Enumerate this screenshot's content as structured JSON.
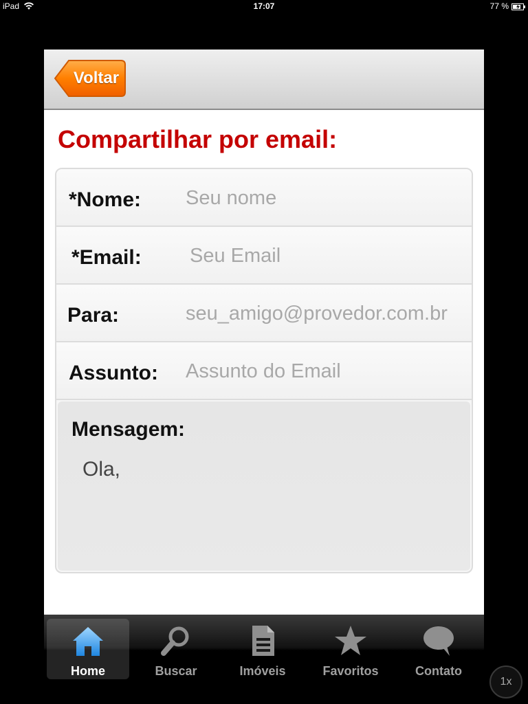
{
  "status_bar": {
    "device": "iPad",
    "time": "17:07",
    "battery": "77 %"
  },
  "header": {
    "back_label": "Voltar"
  },
  "page": {
    "title": "Compartilhar por email:"
  },
  "form": {
    "name": {
      "label": "*Nome:",
      "placeholder": "Seu nome",
      "value": ""
    },
    "email": {
      "label": "*Email:",
      "placeholder": "Seu Email",
      "value": ""
    },
    "to": {
      "label": "Para:",
      "placeholder": "seu_amigo@provedor.com.br",
      "value": ""
    },
    "subject": {
      "label": "Assunto:",
      "placeholder": "Assunto do Email",
      "value": ""
    },
    "message": {
      "label": "Mensagem:",
      "value": "Ola,"
    }
  },
  "tabbar": {
    "tabs": [
      {
        "label": "Home",
        "icon": "home-icon",
        "active": true
      },
      {
        "label": "Buscar",
        "icon": "search-icon",
        "active": false
      },
      {
        "label": "Imóveis",
        "icon": "document-icon",
        "active": false
      },
      {
        "label": "Favoritos",
        "icon": "star-icon",
        "active": false
      },
      {
        "label": "Contato",
        "icon": "chat-bubble-icon",
        "active": false
      }
    ]
  },
  "zoom": {
    "label": "1x"
  },
  "colors": {
    "title": "#c40000",
    "back_button": "#ff7a00",
    "home_icon": "#3ea2f0"
  }
}
